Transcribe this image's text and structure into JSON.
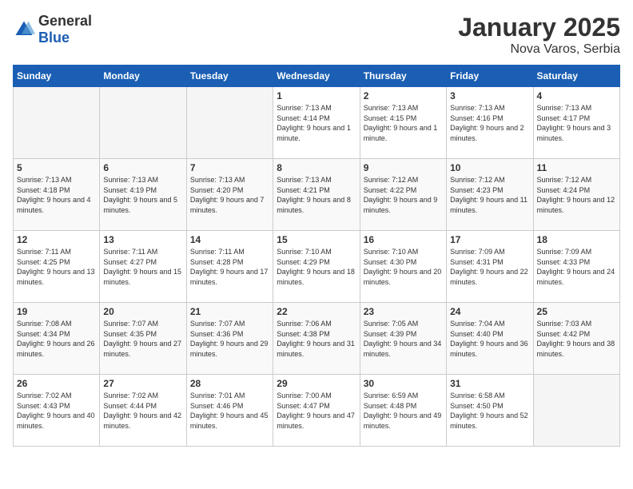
{
  "logo": {
    "general": "General",
    "blue": "Blue"
  },
  "header": {
    "month": "January 2025",
    "location": "Nova Varos, Serbia"
  },
  "weekdays": [
    "Sunday",
    "Monday",
    "Tuesday",
    "Wednesday",
    "Thursday",
    "Friday",
    "Saturday"
  ],
  "weeks": [
    [
      {
        "day": "",
        "empty": true
      },
      {
        "day": "",
        "empty": true
      },
      {
        "day": "",
        "empty": true
      },
      {
        "day": "1",
        "sunrise": "7:13 AM",
        "sunset": "4:14 PM",
        "daylight": "9 hours and 1 minute."
      },
      {
        "day": "2",
        "sunrise": "7:13 AM",
        "sunset": "4:15 PM",
        "daylight": "9 hours and 1 minute."
      },
      {
        "day": "3",
        "sunrise": "7:13 AM",
        "sunset": "4:16 PM",
        "daylight": "9 hours and 2 minutes."
      },
      {
        "day": "4",
        "sunrise": "7:13 AM",
        "sunset": "4:17 PM",
        "daylight": "9 hours and 3 minutes."
      }
    ],
    [
      {
        "day": "5",
        "sunrise": "7:13 AM",
        "sunset": "4:18 PM",
        "daylight": "9 hours and 4 minutes."
      },
      {
        "day": "6",
        "sunrise": "7:13 AM",
        "sunset": "4:19 PM",
        "daylight": "9 hours and 5 minutes."
      },
      {
        "day": "7",
        "sunrise": "7:13 AM",
        "sunset": "4:20 PM",
        "daylight": "9 hours and 7 minutes."
      },
      {
        "day": "8",
        "sunrise": "7:13 AM",
        "sunset": "4:21 PM",
        "daylight": "9 hours and 8 minutes."
      },
      {
        "day": "9",
        "sunrise": "7:12 AM",
        "sunset": "4:22 PM",
        "daylight": "9 hours and 9 minutes."
      },
      {
        "day": "10",
        "sunrise": "7:12 AM",
        "sunset": "4:23 PM",
        "daylight": "9 hours and 11 minutes."
      },
      {
        "day": "11",
        "sunrise": "7:12 AM",
        "sunset": "4:24 PM",
        "daylight": "9 hours and 12 minutes."
      }
    ],
    [
      {
        "day": "12",
        "sunrise": "7:11 AM",
        "sunset": "4:25 PM",
        "daylight": "9 hours and 13 minutes."
      },
      {
        "day": "13",
        "sunrise": "7:11 AM",
        "sunset": "4:27 PM",
        "daylight": "9 hours and 15 minutes."
      },
      {
        "day": "14",
        "sunrise": "7:11 AM",
        "sunset": "4:28 PM",
        "daylight": "9 hours and 17 minutes."
      },
      {
        "day": "15",
        "sunrise": "7:10 AM",
        "sunset": "4:29 PM",
        "daylight": "9 hours and 18 minutes."
      },
      {
        "day": "16",
        "sunrise": "7:10 AM",
        "sunset": "4:30 PM",
        "daylight": "9 hours and 20 minutes."
      },
      {
        "day": "17",
        "sunrise": "7:09 AM",
        "sunset": "4:31 PM",
        "daylight": "9 hours and 22 minutes."
      },
      {
        "day": "18",
        "sunrise": "7:09 AM",
        "sunset": "4:33 PM",
        "daylight": "9 hours and 24 minutes."
      }
    ],
    [
      {
        "day": "19",
        "sunrise": "7:08 AM",
        "sunset": "4:34 PM",
        "daylight": "9 hours and 26 minutes."
      },
      {
        "day": "20",
        "sunrise": "7:07 AM",
        "sunset": "4:35 PM",
        "daylight": "9 hours and 27 minutes."
      },
      {
        "day": "21",
        "sunrise": "7:07 AM",
        "sunset": "4:36 PM",
        "daylight": "9 hours and 29 minutes."
      },
      {
        "day": "22",
        "sunrise": "7:06 AM",
        "sunset": "4:38 PM",
        "daylight": "9 hours and 31 minutes."
      },
      {
        "day": "23",
        "sunrise": "7:05 AM",
        "sunset": "4:39 PM",
        "daylight": "9 hours and 34 minutes."
      },
      {
        "day": "24",
        "sunrise": "7:04 AM",
        "sunset": "4:40 PM",
        "daylight": "9 hours and 36 minutes."
      },
      {
        "day": "25",
        "sunrise": "7:03 AM",
        "sunset": "4:42 PM",
        "daylight": "9 hours and 38 minutes."
      }
    ],
    [
      {
        "day": "26",
        "sunrise": "7:02 AM",
        "sunset": "4:43 PM",
        "daylight": "9 hours and 40 minutes."
      },
      {
        "day": "27",
        "sunrise": "7:02 AM",
        "sunset": "4:44 PM",
        "daylight": "9 hours and 42 minutes."
      },
      {
        "day": "28",
        "sunrise": "7:01 AM",
        "sunset": "4:46 PM",
        "daylight": "9 hours and 45 minutes."
      },
      {
        "day": "29",
        "sunrise": "7:00 AM",
        "sunset": "4:47 PM",
        "daylight": "9 hours and 47 minutes."
      },
      {
        "day": "30",
        "sunrise": "6:59 AM",
        "sunset": "4:48 PM",
        "daylight": "9 hours and 49 minutes."
      },
      {
        "day": "31",
        "sunrise": "6:58 AM",
        "sunset": "4:50 PM",
        "daylight": "9 hours and 52 minutes."
      },
      {
        "day": "",
        "empty": true
      }
    ]
  ],
  "labels": {
    "sunrise": "Sunrise:",
    "sunset": "Sunset:",
    "daylight": "Daylight hours"
  }
}
